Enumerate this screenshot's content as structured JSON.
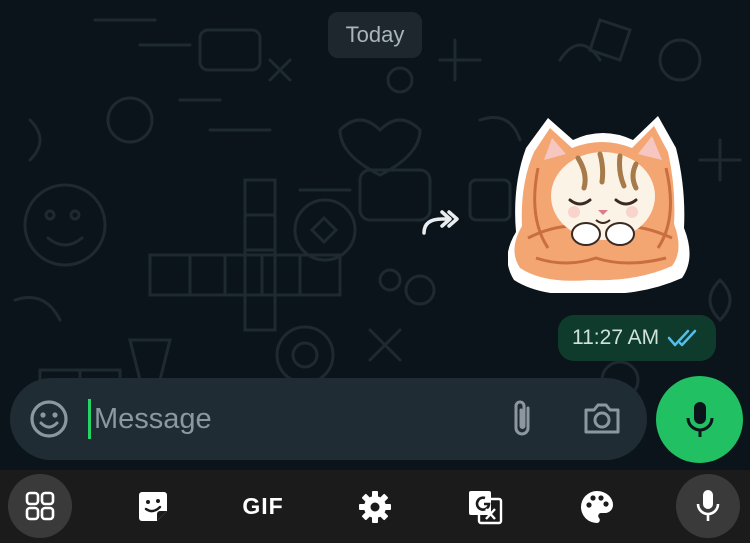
{
  "colors": {
    "background": "#0b141a",
    "accent": "#21c063",
    "bubble_out": "#0f3b2c",
    "read_ticks": "#53bdeb",
    "input_bar": "#1f2c33"
  },
  "chat": {
    "date_divider": "Today",
    "message": {
      "type": "sticker",
      "sticker_icon": "cat-in-blanket-sticker",
      "time": "11:27 AM",
      "status_icon": "double-check-read-icon"
    },
    "forward_icon": "forward-arrow-icon"
  },
  "composer": {
    "placeholder": "Message",
    "value": "",
    "emoji_icon": "emoji-icon",
    "attach_icon": "paperclip-icon",
    "camera_icon": "camera-icon",
    "send_icon": "microphone-icon"
  },
  "keyboard_toolbar": {
    "items": [
      {
        "icon": "apps-grid-icon"
      },
      {
        "icon": "sticker-icon"
      },
      {
        "label": "GIF"
      },
      {
        "icon": "gear-icon"
      },
      {
        "icon": "translate-icon"
      },
      {
        "icon": "palette-icon"
      },
      {
        "icon": "microphone-icon"
      }
    ]
  }
}
